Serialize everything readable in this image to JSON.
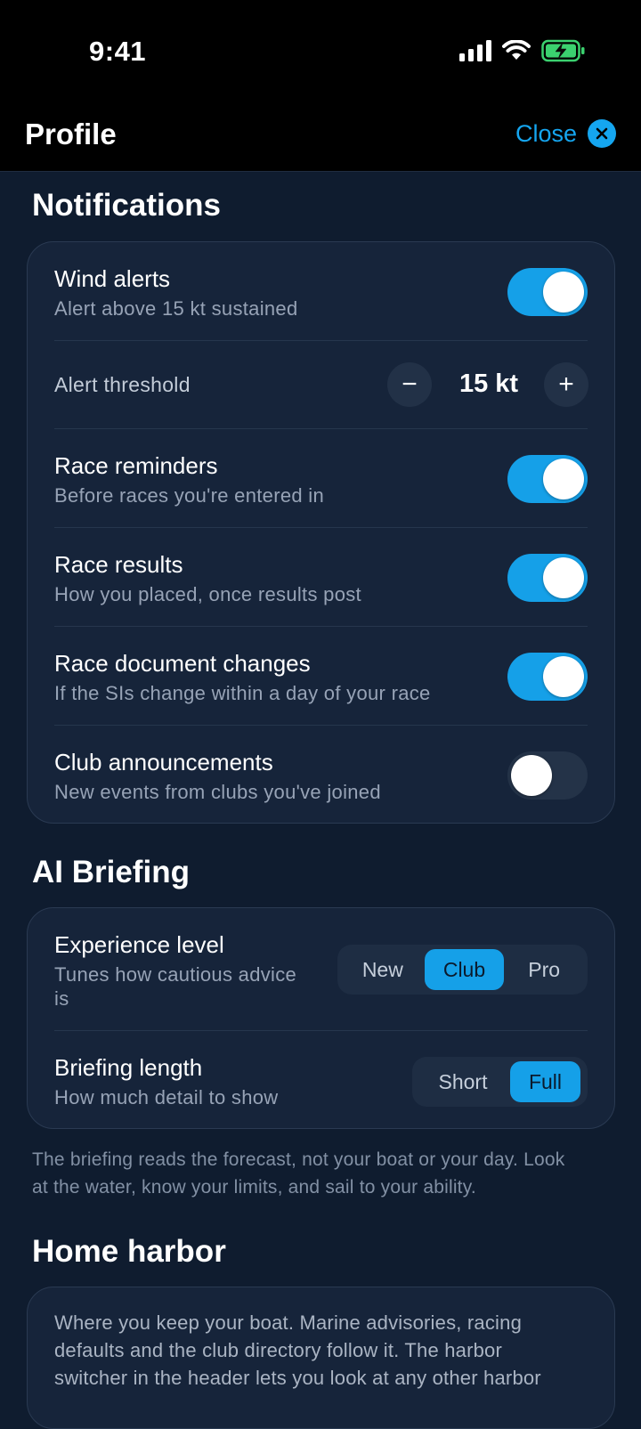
{
  "status_bar": {
    "time": "9:41"
  },
  "header": {
    "title": "Profile",
    "close_label": "Close"
  },
  "notifications": {
    "title": "Notifications",
    "wind_alerts": {
      "title": "Wind alerts",
      "subtitle": "Alert above 15 kt sustained",
      "enabled": true
    },
    "alert_threshold": {
      "label": "Alert threshold",
      "value": "15 kt",
      "minus": "−",
      "plus": "+"
    },
    "race_reminders": {
      "title": "Race reminders",
      "subtitle": "Before races you're entered in",
      "enabled": true
    },
    "race_results": {
      "title": "Race results",
      "subtitle": "How you placed, once results post",
      "enabled": true
    },
    "race_document_changes": {
      "title": "Race document changes",
      "subtitle": "If the SIs change within a day of your race",
      "enabled": true
    },
    "club_announcements": {
      "title": "Club announcements",
      "subtitle": "New events from clubs you've joined",
      "enabled": false
    }
  },
  "ai_briefing": {
    "title": "AI Briefing",
    "experience_level": {
      "title": "Experience level",
      "subtitle_line1": "Tunes how cautious advice",
      "subtitle_line2": "is",
      "options": [
        "New",
        "Club",
        "Pro"
      ],
      "selected": "Club"
    },
    "briefing_length": {
      "title": "Briefing length",
      "subtitle": "How much detail to show",
      "options": [
        "Short",
        "Full"
      ],
      "selected": "Full"
    },
    "note_line1": "The briefing reads the forecast, not your boat or your day. Look",
    "note_line2": "at the water, know your limits, and sail to your ability."
  },
  "home_harbor": {
    "title": "Home harbor",
    "text_line1": "Where you keep your boat. Marine advisories, racing",
    "text_line2": "defaults and the club directory follow it. The harbor",
    "text_line3": "switcher in the header lets you look at any other harbor"
  },
  "colors": {
    "accent": "#15a0e8",
    "background": "#0f1c2f",
    "card": "#16243a"
  }
}
